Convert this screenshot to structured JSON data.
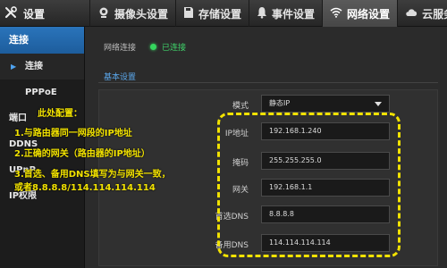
{
  "header": {
    "title": "设置",
    "tabs": [
      {
        "label": "摄像头设置",
        "icon": "camera-icon"
      },
      {
        "label": "存储设置",
        "icon": "storage-icon"
      },
      {
        "label": "事件设置",
        "icon": "bell-icon"
      },
      {
        "label": "网络设置",
        "icon": "wifi-icon",
        "active": true
      },
      {
        "label": "云服务",
        "icon": "cloud-icon"
      }
    ]
  },
  "sidebar": {
    "head": "连接",
    "items": [
      {
        "label": "连接",
        "selected": true
      },
      {
        "label": "PPPoE"
      },
      {
        "label": "端口"
      },
      {
        "label": "DDNS"
      },
      {
        "label": "UPnP"
      },
      {
        "label": "IP权限"
      }
    ]
  },
  "status": {
    "label": "网络连接",
    "value": "已连接"
  },
  "section": {
    "title": "基本设置"
  },
  "form": {
    "mode_label": "模式",
    "mode_value": "静态IP",
    "ip_label": "IP地址",
    "ip_value": "192.168.1.240",
    "mask_label": "掩码",
    "mask_value": "255.255.255.0",
    "gateway_label": "网关",
    "gateway_value": "192.168.1.1",
    "dns1_label": "首选DNS",
    "dns1_value": "8.8.8.8",
    "dns2_label": "备用DNS",
    "dns2_value": "114.114.114.114"
  },
  "annotation": {
    "heading": "此处配置：",
    "line1": "1.与路由器同一网段的IP地址",
    "line2": "2.正确的网关（路由器的IP地址）",
    "line3": "3.首选、备用DNS填写为与网关一致，",
    "line4": "或者8.8.8.8/114.114.114.114",
    "color": "#f2e200"
  },
  "colors": {
    "accent": "#2a74bb",
    "status_ok": "#3fd36a"
  }
}
